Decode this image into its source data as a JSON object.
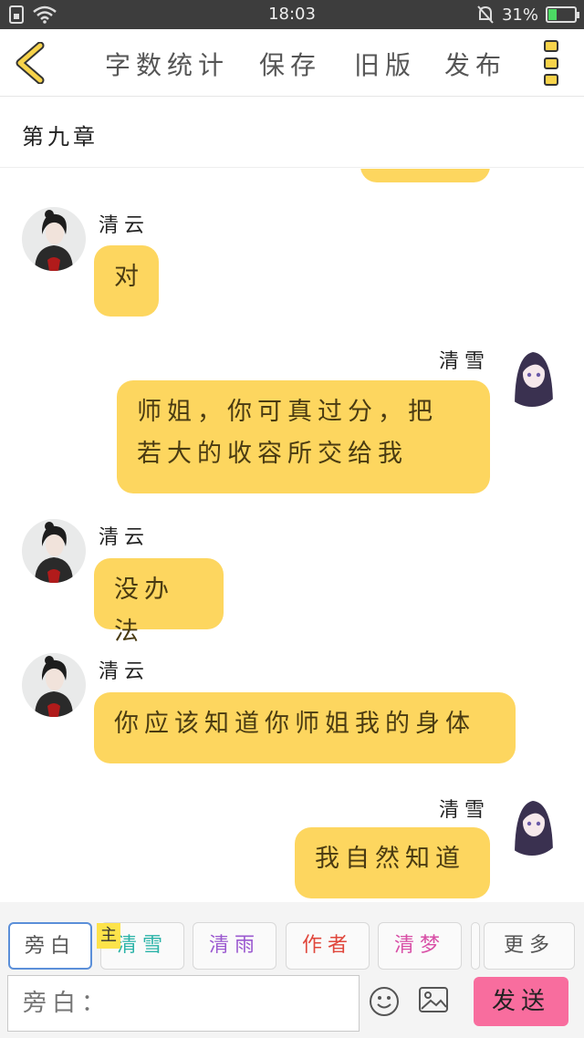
{
  "status_bar": {
    "time": "18:03",
    "battery": "31%"
  },
  "toolbar": {
    "word_count": "字数统计",
    "save": "保存",
    "old_version": "旧版",
    "publish": "发布"
  },
  "chapter": {
    "title": "第九章"
  },
  "messages": [
    {
      "speaker": "清云",
      "side": "left",
      "text": "对"
    },
    {
      "speaker": "清雪",
      "side": "right",
      "line1": "师姐，你可真过分，把",
      "line2": "若大的收容所交给我"
    },
    {
      "speaker": "清云",
      "side": "left",
      "text": "没办法"
    },
    {
      "speaker": "清云",
      "side": "left",
      "text": "你应该知道你师姐我的身体"
    },
    {
      "speaker": "清雪",
      "side": "right",
      "text": "我自然知道"
    }
  ],
  "roles": [
    {
      "label": "旁白",
      "color": "#555555"
    },
    {
      "label": "清雪",
      "color": "#2bb3a8"
    },
    {
      "label": "清雨",
      "color": "#9b59d0"
    },
    {
      "label": "作者",
      "color": "#e0473c"
    },
    {
      "label": "清梦",
      "color": "#d84fa6"
    },
    {
      "label": "更多",
      "color": "#555555"
    }
  ],
  "main_tag": "主",
  "input": {
    "placeholder": "旁白："
  },
  "send_label": "发送",
  "colors": {
    "bubble": "#fdd65f",
    "send": "#f86d9e",
    "accent": "#f7d34a"
  }
}
